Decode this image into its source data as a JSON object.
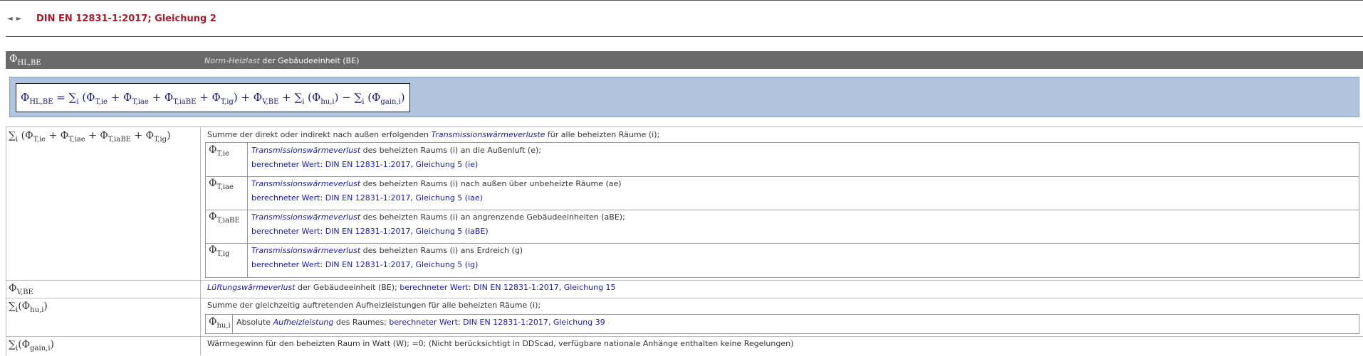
{
  "nav": {
    "prev": "◄",
    "next": "►"
  },
  "title": "DIN EN 12831-1:2017; Gleichung 2",
  "header": {
    "symbol_main": "Φ",
    "symbol_sub": "HL,BE",
    "desc_italic": "Norm-Heizlast",
    "desc_rest": " der Gebäudeeinheit (BE)"
  },
  "equation": "Φ HL,BE = ∑ i (Φ T,ie + Φ T,iae + Φ T,iaBE + Φ T,ig ) + Φ V,BE + ∑ i (Φ hu,i ) − ∑ i (Φ gain,i )",
  "rows": {
    "transmission": {
      "symbol": "∑ i (Φ T,ie + Φ T,iae + Φ T,iaBE + Φ T,ig )",
      "desc_pre": "Summe der direkt oder indirekt nach außen erfolgenden ",
      "desc_link": "Transmissionswärmeverluste",
      "desc_post": " für alle beheizten Räume (i);",
      "items": [
        {
          "sym": "Φ",
          "sub": "T,ie",
          "link": "Transmissionswärmeverlust",
          "text": " des beheizten Raums (i) an die Außenluft (e);",
          "calc": "berechneter Wert: DIN EN 12831-1:2017, Gleichung 5 (ie)"
        },
        {
          "sym": "Φ",
          "sub": "T,iae",
          "link": "Transmissionswärmeverlust",
          "text": " des beheizten Raums (i) nach außen über unbeheizte Räume (ae)",
          "calc": "berechneter Wert: DIN EN 12831-1:2017, Gleichung 5 (iae)"
        },
        {
          "sym": "Φ",
          "sub": "T,iaBE",
          "link": "Transmissionswärmeverlust",
          "text": " des beheizten Raums (i) an angrenzende Gebäudeeinheiten (aBE);",
          "calc": "berechneter Wert: DIN EN 12831-1:2017, Gleichung 5 (iaBE)"
        },
        {
          "sym": "Φ",
          "sub": "T,ig",
          "link": "Transmissionswärmeverlust",
          "text": " des beheizten Raums (i) ans Erdreich (g)",
          "calc": "berechneter Wert: DIN EN 12831-1:2017, Gleichung 5 (ig)"
        }
      ]
    },
    "ventilation": {
      "sym": "Φ",
      "sub": "V,BE",
      "link": "Lüftungswärmeverlust",
      "text": " der Gebäudeeinheit (BE); ",
      "calc": "berechneter Wert: DIN EN 12831-1:2017, Gleichung 15"
    },
    "heatup": {
      "sym": "∑",
      "sub": "i",
      "inner_sym": "Φ",
      "inner_sub": "hu,i",
      "desc": "Summe der gleichzeitig auftretenden Aufheizleistungen für alle beheizten Räume (i);",
      "item": {
        "sym": "Φ",
        "sub": "hu,i",
        "pre": "Absolute ",
        "link": "Aufheizleistung",
        "text": " des Raumes; ",
        "calc": "berechneter Wert: DIN EN 12831-1:2017, Gleichung 39"
      }
    },
    "gain": {
      "sym": "∑",
      "sub": "i",
      "inner_sym": "Φ",
      "inner_sub": "gain,i",
      "desc": "Wärmegewinn für den beheizten Raum in Watt (W); =0; (Nicht berücksichtigt in DDScad, verfügbare nationale Anhänge enthalten keine Regelungen)"
    }
  }
}
